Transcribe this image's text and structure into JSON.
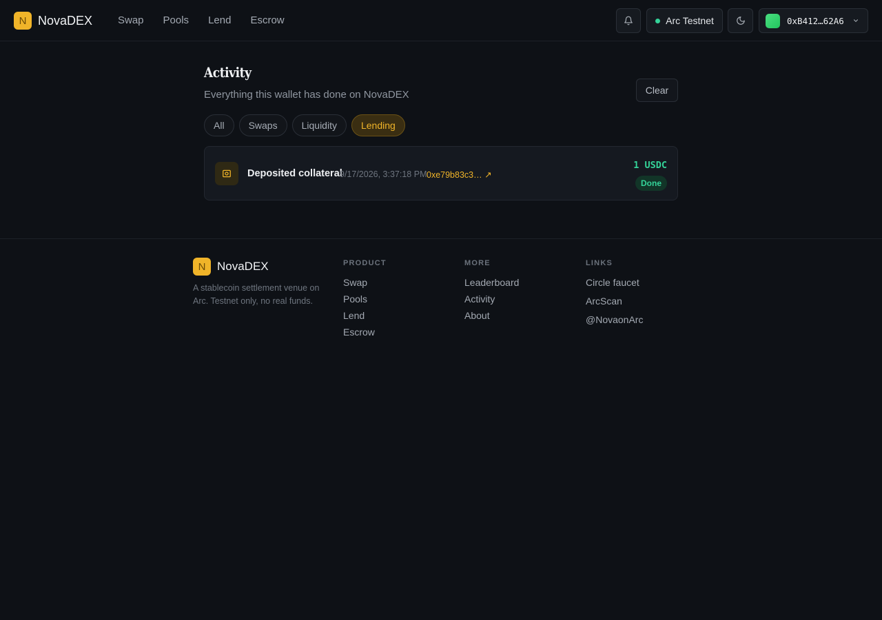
{
  "header": {
    "brand_letter": "N",
    "brand_name": "NovaDEX",
    "nav": [
      "Swap",
      "Pools",
      "Lend",
      "Escrow"
    ],
    "network": "Arc Testnet",
    "wallet_address": "0xB412…62A6"
  },
  "page": {
    "title": "Activity",
    "subtitle": "Everything this wallet has done on NovaDEX",
    "clear_label": "Clear",
    "filters": [
      "All",
      "Swaps",
      "Liquidity",
      "Lending"
    ],
    "active_filter": "Lending"
  },
  "activity": [
    {
      "label": "Deposited collateral",
      "time": "9/17/2026, 3:37:18 PM",
      "tx": "0xe79b83c3… ↗",
      "amount": "1 USDC",
      "status": "Done"
    }
  ],
  "footer": {
    "brand_letter": "N",
    "brand_name": "NovaDEX",
    "description": "A stablecoin settlement venue on Arc. Testnet only, no real funds.",
    "product": {
      "heading": "PRODUCT",
      "links": [
        "Swap",
        "Pools",
        "Lend",
        "Escrow"
      ]
    },
    "more": {
      "heading": "MORE",
      "links": [
        "Leaderboard",
        "Activity",
        "About"
      ]
    },
    "links": {
      "heading": "LINKS",
      "links": [
        "Circle faucet",
        "ArcScan",
        "@NovaonArc"
      ]
    }
  },
  "colors": {
    "background": "#0e1116",
    "accent": "#f0b429",
    "success": "#34d399"
  }
}
